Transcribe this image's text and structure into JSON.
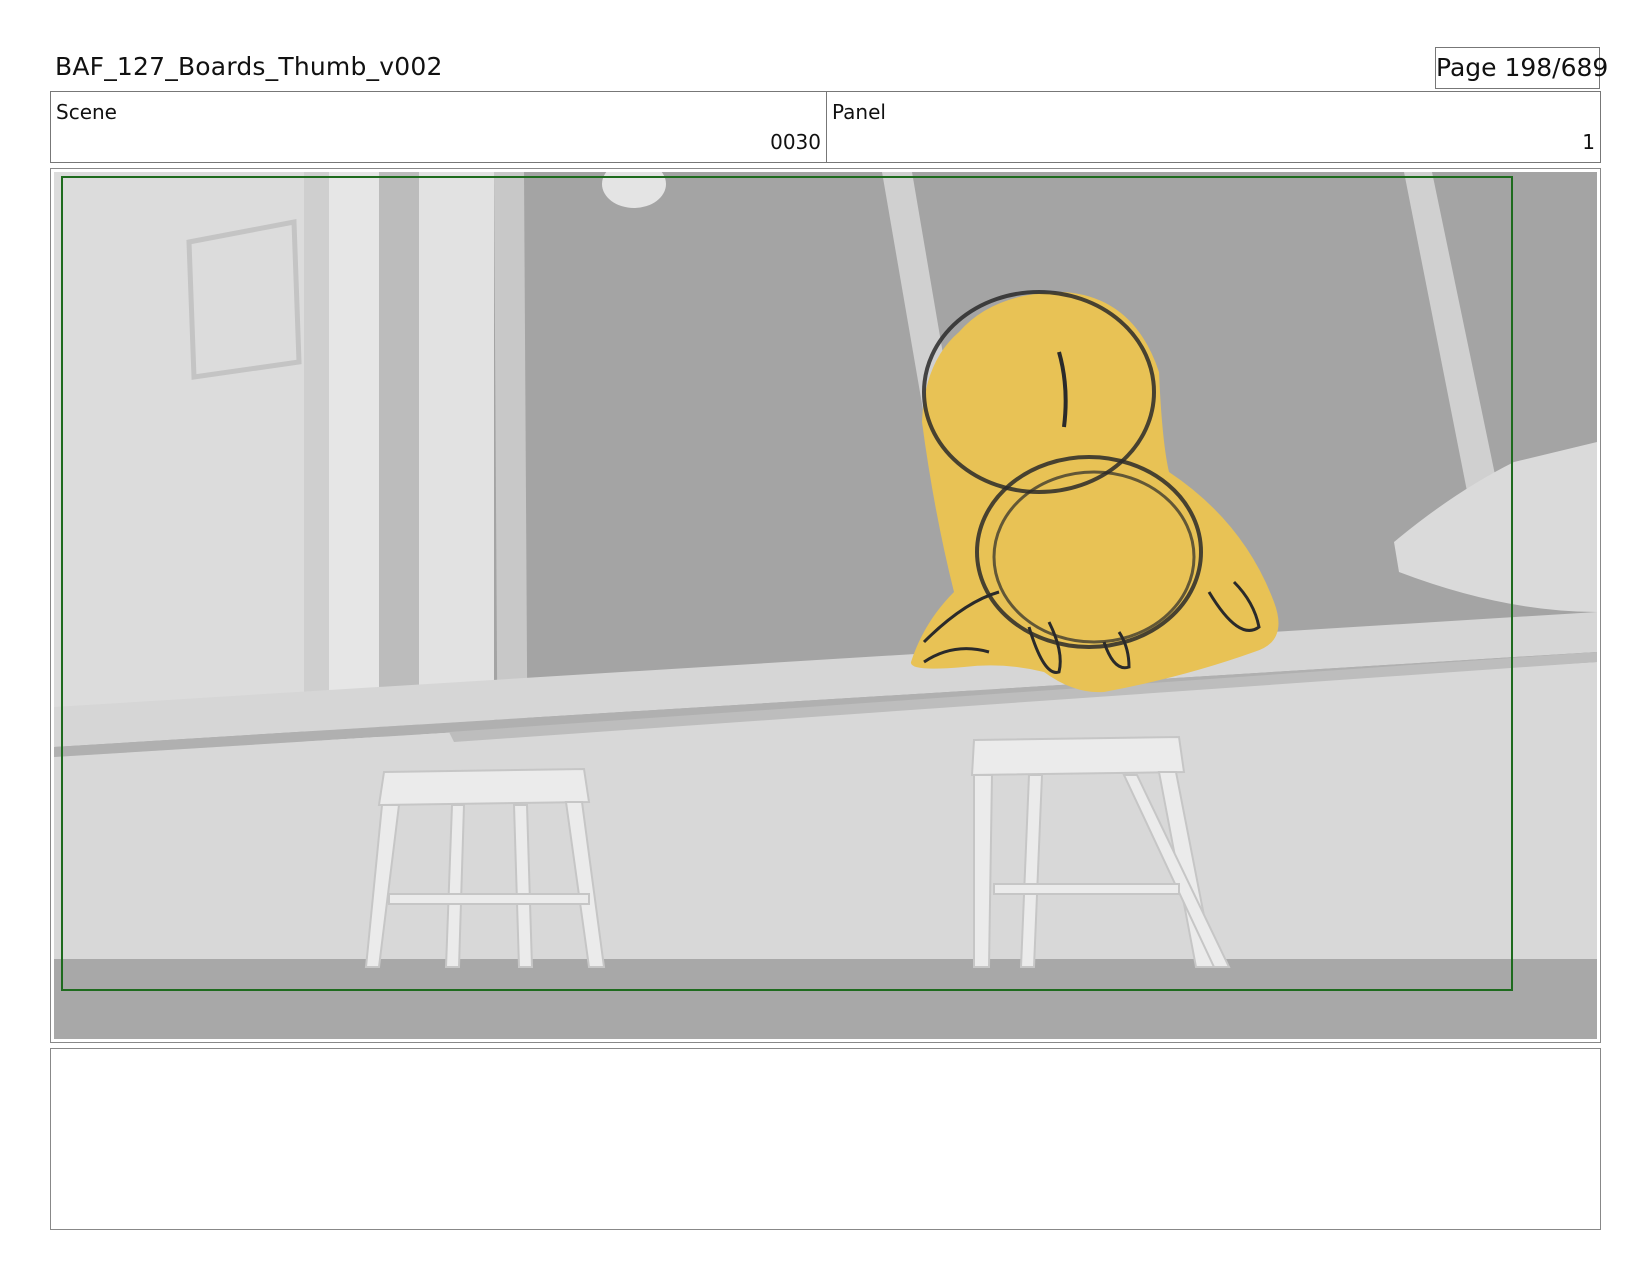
{
  "header": {
    "title": "BAF_127_Boards_Thumb_v002",
    "page": "Page 198/689"
  },
  "info": {
    "scene_label": "Scene",
    "scene_value": "0030",
    "panel_label": "Panel",
    "panel_value": "1"
  },
  "notes": {
    "text": ""
  },
  "colors": {
    "safe_frame": "#1e6b1e",
    "character_fill": "#e8c255",
    "sketch_line": "#2a2a2a",
    "background_gray": "#a4a4a4"
  }
}
